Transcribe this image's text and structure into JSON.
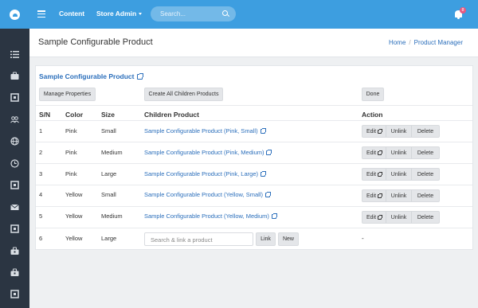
{
  "topbar": {
    "nav_content": "Content",
    "nav_store_admin": "Store Admin",
    "search_placeholder": "Search...",
    "notification_count": "8"
  },
  "header": {
    "page_title": "Sample Configurable Product",
    "breadcrumb": [
      "Home",
      "/",
      "Product Manager"
    ]
  },
  "panel": {
    "product_link": "Sample Configurable Product",
    "buttons": {
      "manage_properties": "Manage Properties",
      "create_children": "Create All Children Products",
      "done": "Done"
    },
    "columns": [
      "S/N",
      "Color",
      "Size",
      "Children Product",
      "Action"
    ],
    "rows": [
      {
        "sn": "1",
        "color": "Pink",
        "size": "Small",
        "child": "Sample Configurable Product (Pink, Small)"
      },
      {
        "sn": "2",
        "color": "Pink",
        "size": "Medium",
        "child": "Sample Configurable Product (Pink, Medium)"
      },
      {
        "sn": "3",
        "color": "Pink",
        "size": "Large",
        "child": "Sample Configurable Product (Pink, Large)"
      },
      {
        "sn": "4",
        "color": "Yellow",
        "size": "Small",
        "child": "Sample Configurable Product (Yellow, Small)"
      },
      {
        "sn": "5",
        "color": "Yellow",
        "size": "Medium",
        "child": "Sample Configurable Product (Yellow, Medium)"
      }
    ],
    "actions": {
      "edit": "Edit",
      "unlink": "Unlink",
      "delete": "Delete"
    },
    "link_row": {
      "sn": "6",
      "color": "Yellow",
      "size": "Large",
      "input_placeholder": "Search & link a product",
      "link_label": "Link",
      "new_label": "New",
      "action": "-"
    }
  },
  "sidebar_icons": [
    "list-icon",
    "briefcase-icon",
    "puzzle-icon",
    "users-icon",
    "globe-icon",
    "clock-icon",
    "puzzle-icon",
    "mail-icon",
    "puzzle-icon",
    "toolbox-icon",
    "toolbox-icon",
    "puzzle-icon"
  ],
  "colors": {
    "topbar": "#3d9ee0",
    "sidebar": "#2b3542",
    "link": "#2a6ebb",
    "badge": "#e8577f"
  }
}
